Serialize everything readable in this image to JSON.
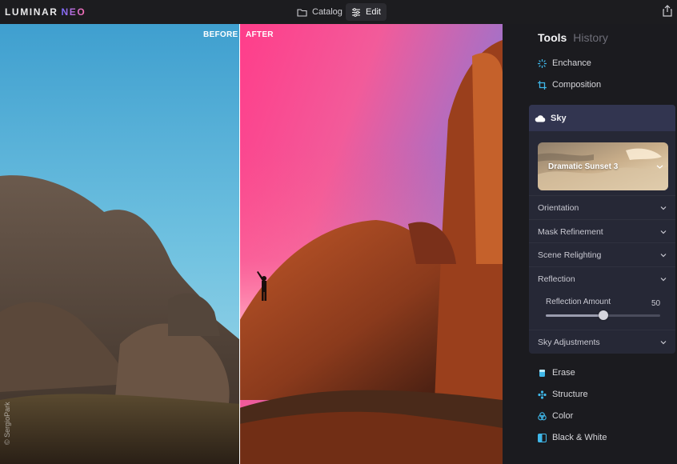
{
  "app": {
    "logo_main": "LUMINAR",
    "logo_accent": "NEO"
  },
  "nav": {
    "catalog_label": "Catalog",
    "edit_label": "Edit",
    "active": "Edit"
  },
  "photo": {
    "before_label": "BEFORE",
    "after_label": "AFTER",
    "watermark": "© SergioPark"
  },
  "panel": {
    "tabs": [
      {
        "label": "Tools",
        "active": true
      },
      {
        "label": "History",
        "active": false
      }
    ],
    "top_tools": [
      {
        "label": "Enchance",
        "icon": "sparkle-icon",
        "color": "#3fb7e8"
      },
      {
        "label": "Composition",
        "icon": "crop-icon",
        "color": "#3fb7e8"
      }
    ],
    "sky": {
      "title": "Sky",
      "icon": "cloud-icon",
      "preset_label": "Dramatic Sunset 3",
      "sections": [
        {
          "label": "Orientation"
        },
        {
          "label": "Mask Refinement"
        },
        {
          "label": "Scene Relighting"
        },
        {
          "label": "Reflection"
        }
      ],
      "reflection_amount_label": "Reflection Amount",
      "reflection_amount": 50,
      "reflection_amount_max": 100,
      "adjustments_label": "Sky Adjustments"
    },
    "bottom_tools": [
      {
        "label": "Erase",
        "icon": "eraser-icon"
      },
      {
        "label": "Structure",
        "icon": "structure-icon"
      },
      {
        "label": "Color",
        "icon": "color-icon"
      },
      {
        "label": "Black & White",
        "icon": "black-white-icon"
      }
    ]
  },
  "colors": {
    "accent_blue": "#3fb7e8",
    "sky_header": "#323550",
    "panel_bg": "#1b1b1f"
  }
}
